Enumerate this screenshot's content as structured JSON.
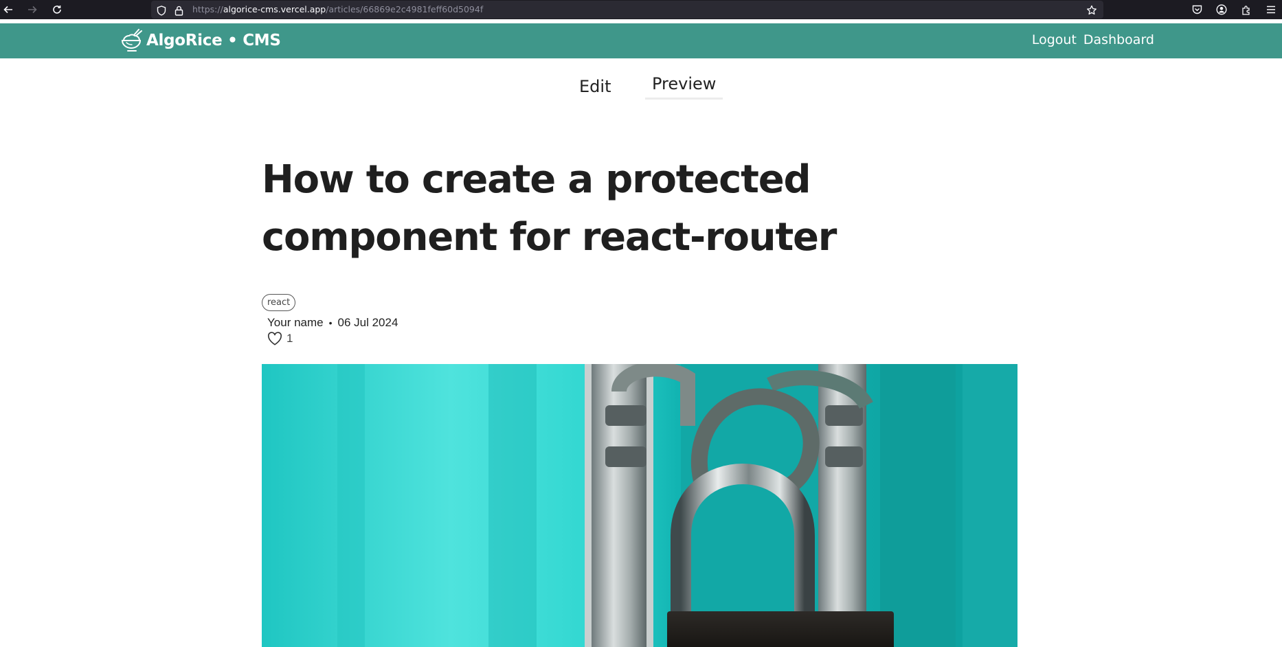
{
  "browser": {
    "url_scheme": "https://",
    "url_host": "algorice-cms.vercel.app",
    "url_path": "/articles/66869e2c4981feff60d5094f",
    "icons": [
      "back-icon",
      "forward-icon",
      "reload-icon",
      "shield-icon",
      "lock-icon",
      "bookmark-star-icon",
      "pocket-icon",
      "account-icon",
      "extensions-icon",
      "menu-icon"
    ]
  },
  "header": {
    "brand": "AlgoRice • CMS",
    "logout_label": "Logout",
    "dashboard_label": "Dashboard",
    "color": "#3f978a"
  },
  "tabs": [
    {
      "label": "Edit",
      "active": false
    },
    {
      "label": "Preview",
      "active": true
    }
  ],
  "article": {
    "title": "How to create a protected component for react-router",
    "tag": "react",
    "author": "Your name",
    "separator": "•",
    "date": "06 Jul 2024",
    "likes": "1",
    "cover_description": "padlock on teal door"
  }
}
